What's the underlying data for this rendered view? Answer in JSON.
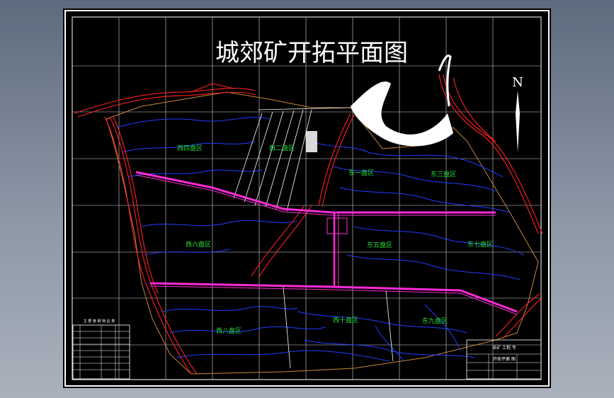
{
  "title": "城郊矿开拓平面图",
  "north_label": "N",
  "panels": [
    {
      "id": "xi-si",
      "label": "西四盘区"
    },
    {
      "id": "xi-er",
      "label": "西二盘区"
    },
    {
      "id": "dong-yi",
      "label": "东一盘区"
    },
    {
      "id": "dong-san",
      "label": "东三盘区"
    },
    {
      "id": "xi-liu",
      "label": "西六盘区"
    },
    {
      "id": "dong-wu",
      "label": "东五盘区"
    },
    {
      "id": "dong-qi",
      "label": "东七盘区"
    },
    {
      "id": "xi-ba",
      "label": "西八盘区"
    },
    {
      "id": "xi-shi",
      "label": "西十盘区"
    },
    {
      "id": "dong-jiu",
      "label": "东九盘区"
    }
  ],
  "title_block": {
    "row1": "采矿 工程 专",
    "row2": "开拓平面 图"
  },
  "legend_table": {
    "header": "主 要 巷 硐 特 征 表"
  },
  "colors": {
    "frame": "#ffffff",
    "grid": "#d8d8d8",
    "contour": "#1f3dff",
    "fault": "#ff1f1f",
    "roadway": "#ff2bd6",
    "label": "#25e03a",
    "boundary": "#c8873a",
    "background": "#000000"
  }
}
